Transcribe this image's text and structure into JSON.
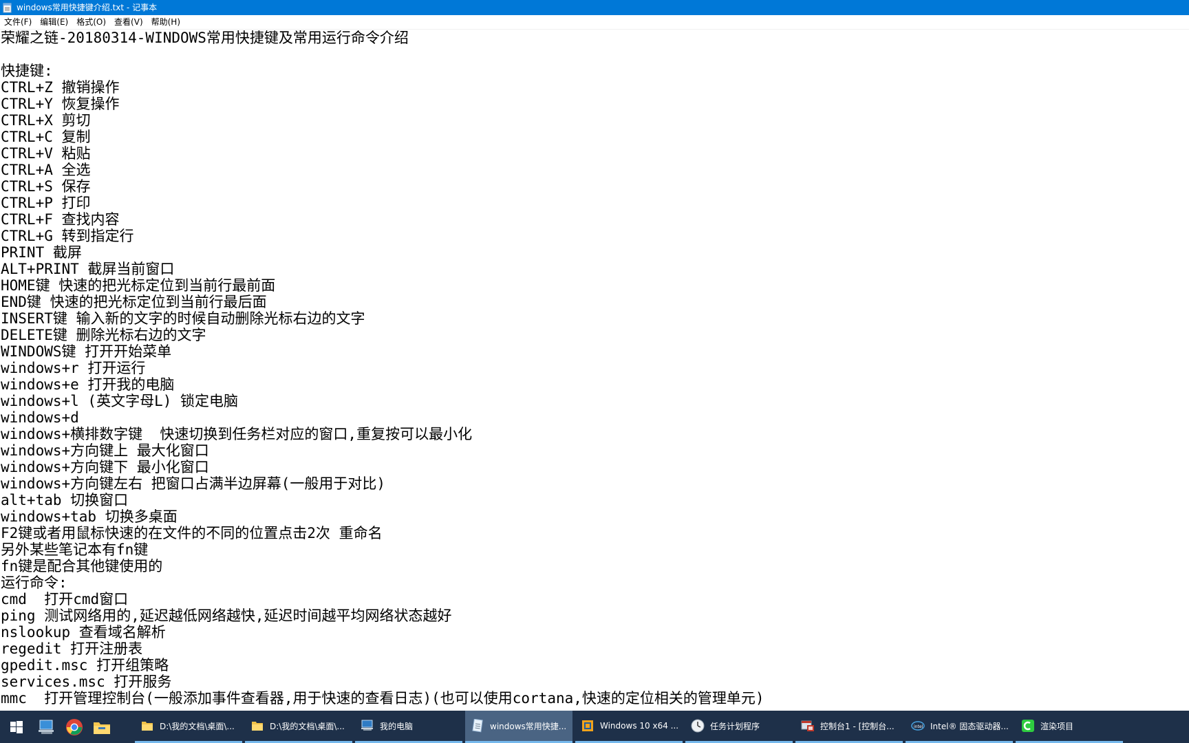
{
  "window": {
    "title": "windows常用快捷键介绍.txt - 记事本"
  },
  "menu": [
    "文件(F)",
    "编辑(E)",
    "格式(O)",
    "查看(V)",
    "帮助(H)"
  ],
  "document": {
    "lines": [
      "荣耀之链-20180314-WINDOWS常用快捷键及常用运行命令介绍",
      "",
      "快捷键:",
      "CTRL+Z 撤销操作",
      "CTRL+Y 恢复操作",
      "CTRL+X 剪切",
      "CTRL+C 复制",
      "CTRL+V 粘贴",
      "CTRL+A 全选",
      "CTRL+S 保存",
      "CTRL+P 打印",
      "CTRL+F 查找内容",
      "CTRL+G 转到指定行",
      "PRINT 截屏",
      "ALT+PRINT 截屏当前窗口",
      "HOME键 快速的把光标定位到当前行最前面",
      "END键 快速的把光标定位到当前行最后面",
      "INSERT键 输入新的文字的时候自动删除光标右边的文字",
      "DELETE键 删除光标右边的文字",
      "WINDOWS键 打开开始菜单",
      "windows+r 打开运行",
      "windows+e 打开我的电脑",
      "windows+l (英文字母L) 锁定电脑",
      "windows+d",
      "windows+横排数字键  快速切换到任务栏对应的窗口,重复按可以最小化",
      "windows+方向键上 最大化窗口",
      "windows+方向键下 最小化窗口",
      "windows+方向键左右 把窗口占满半边屏幕(一般用于对比)",
      "alt+tab 切换窗口",
      "windows+tab 切换多桌面",
      "F2键或者用鼠标快速的在文件的不同的位置点击2次 重命名",
      "另外某些笔记本有fn键",
      "fn键是配合其他键使用的",
      "运行命令:",
      "cmd  打开cmd窗口",
      "ping 测试网络用的,延迟越低网络越快,延迟时间越平均网络状态越好",
      "nslookup 查看域名解析",
      "regedit 打开注册表",
      "gpedit.msc 打开组策略",
      "services.msc 打开服务",
      "mmc  打开管理控制台(一般添加事件查看器,用于快速的查看日志)(也可以使用cortana,快速的定位相关的管理单元)"
    ]
  },
  "taskbar": {
    "pinned": [
      {
        "name": "start-icon"
      },
      {
        "name": "desktop-computer-icon"
      },
      {
        "name": "chrome-icon"
      },
      {
        "name": "file-explorer-icon"
      }
    ],
    "tasks": [
      {
        "label": "D:\\我的文档\\桌面\\...",
        "icon": "folder-icon",
        "active": false
      },
      {
        "label": "D:\\我的文档\\桌面\\...",
        "icon": "folder-icon",
        "active": false
      },
      {
        "label": "我的电脑",
        "icon": "computer-icon",
        "active": false
      },
      {
        "label": "windows常用快捷...",
        "icon": "notepad-icon",
        "active": true
      },
      {
        "label": "Windows 10 x64 ...",
        "icon": "vm-icon",
        "active": false
      },
      {
        "label": "任务计划程序",
        "icon": "clock-icon",
        "active": false
      },
      {
        "label": "控制台1 - [控制台...",
        "icon": "console-icon",
        "active": false
      },
      {
        "label": "Intel® 固态驱动器...",
        "icon": "intel-icon",
        "active": false
      },
      {
        "label": "渲染项目",
        "icon": "camtasia-icon",
        "active": false
      }
    ]
  },
  "colors": {
    "titlebar": "#0078d7",
    "taskbar": "#1e3049",
    "taskbar_active": "#4a6483",
    "task_underline": "#76b9ed"
  }
}
